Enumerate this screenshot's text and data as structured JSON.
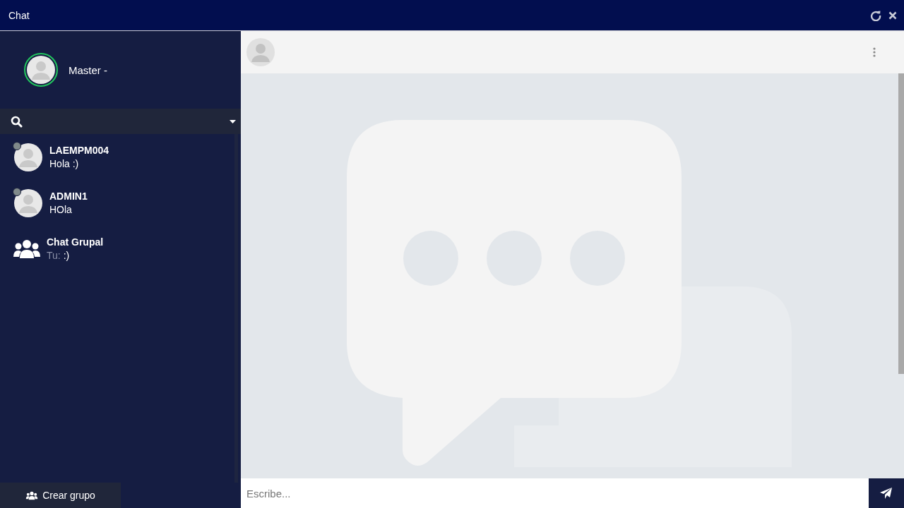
{
  "window": {
    "title": "Chat"
  },
  "profile": {
    "name": "Master -"
  },
  "contacts": [
    {
      "kind": "user",
      "name": "LAEMPM004",
      "message": "Hola :)",
      "online": false
    },
    {
      "kind": "user",
      "name": "ADMIN1",
      "message": "HOla",
      "online": false
    },
    {
      "kind": "group",
      "name": "Chat Grupal",
      "sender": "Tu:",
      "message": ":)"
    }
  ],
  "create_group": {
    "label": "Crear grupo"
  },
  "composer": {
    "placeholder": "Escribe..."
  }
}
